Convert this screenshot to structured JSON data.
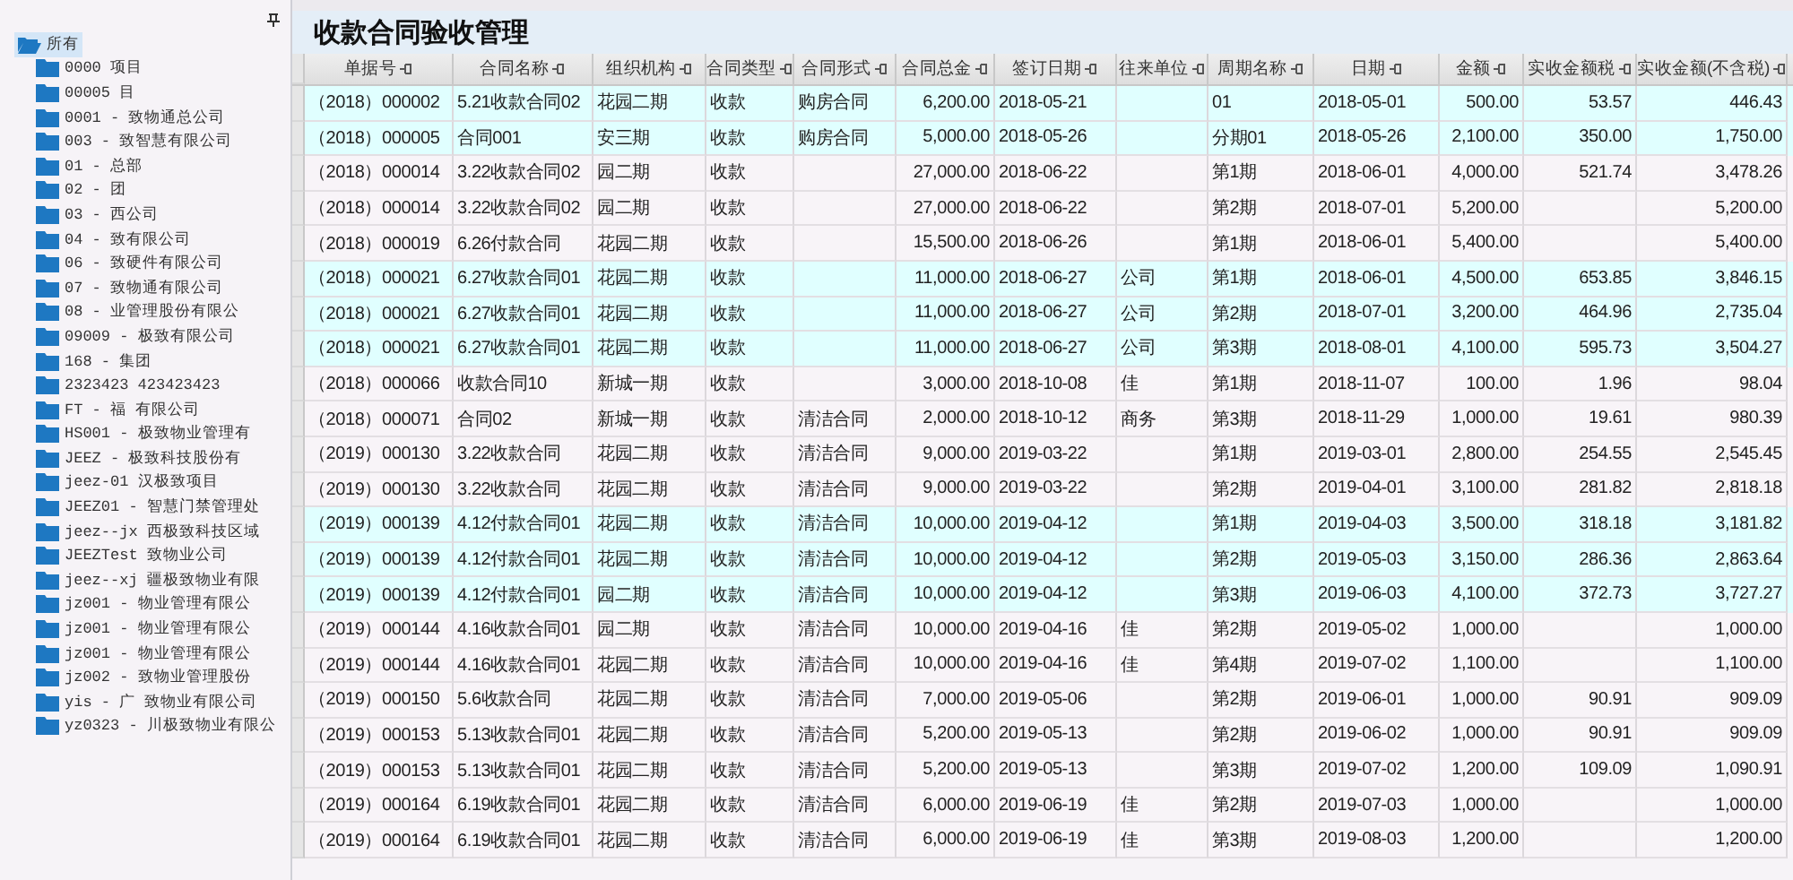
{
  "tree": {
    "root": {
      "label": "所有",
      "selected": true,
      "expanded": true,
      "children": [
        {
          "label": "0000 项目",
          "selected": false
        },
        {
          "label": "00005 目",
          "selected": false
        },
        {
          "label": "0001 - 致物通总公司",
          "selected": false
        },
        {
          "label": "003 - 致智慧有限公司",
          "selected": false
        },
        {
          "label": "01 - 总部",
          "selected": false
        },
        {
          "label": "02 - 团",
          "selected": false
        },
        {
          "label": "03 - 西公司",
          "selected": false
        },
        {
          "label": "04 - 致有限公司",
          "selected": false
        },
        {
          "label": "06 - 致硬件有限公司",
          "selected": false
        },
        {
          "label": "07 - 致物通有限公司",
          "selected": false
        },
        {
          "label": "08 - 业管理股份有限公",
          "selected": false
        },
        {
          "label": "09009 - 极致有限公司",
          "selected": false
        },
        {
          "label": "168 - 集团",
          "selected": false
        },
        {
          "label": "2323423 423423423",
          "selected": false
        },
        {
          "label": "FT - 福 有限公司",
          "selected": false
        },
        {
          "label": "HS001 - 极致物业管理有",
          "selected": false
        },
        {
          "label": "JEEZ - 极致科技股份有",
          "selected": false
        },
        {
          "label": "jeez-01 汉极致项目",
          "selected": false
        },
        {
          "label": "JEEZ01 - 智慧门禁管理处",
          "selected": false
        },
        {
          "label": "jeez--jx 西极致科技区域",
          "selected": false
        },
        {
          "label": "JEEZTest 致物业公司",
          "selected": false
        },
        {
          "label": "jeez--xj 疆极致物业有限",
          "selected": false
        },
        {
          "label": "jz001 - 物业管理有限公",
          "selected": false
        },
        {
          "label": "jz001 - 物业管理有限公",
          "selected": false
        },
        {
          "label": "jz001 - 物业管理有限公",
          "selected": false
        },
        {
          "label": "jz002 - 致物业管理股份",
          "selected": false
        },
        {
          "label": "yis - 广 致物业有限公司",
          "selected": false
        },
        {
          "label": "yz0323 - 川极致物业有限公",
          "selected": false
        }
      ]
    }
  },
  "title": "收款合同验收管理",
  "table": {
    "columns": [
      "单据号",
      "合同名称",
      "组织机构",
      "合同类型",
      "合同形式",
      "合同总金",
      "签订日期",
      "往来单位",
      "周期名称",
      "日期",
      "金额",
      "实收金额税",
      "实收金额(不含税)"
    ],
    "rows": [
      {
        "selected": true,
        "doc_no": "（2018）000002",
        "contract_name": "5.21收款合同02",
        "org": "花园二期",
        "contract_type": "收款",
        "contract_form": "购房合同",
        "total": "6,200.00",
        "sign_date": "2018-05-21",
        "period": "01",
        "date": "2018-05-01",
        "amount": "500.00",
        "tax": "53.57",
        "net": "446.43"
      },
      {
        "selected": true,
        "doc_no": "（2018）000005",
        "contract_name": "合同001",
        "org": "安三期",
        "contract_type": "收款",
        "contract_form": "购房合同",
        "total": "5,000.00",
        "sign_date": "2018-05-26",
        "period": "分期01",
        "date": "2018-05-26",
        "amount": "2,100.00",
        "tax": "350.00",
        "net": "1,750.00"
      },
      {
        "selected": false,
        "doc_no": "（2018）000014",
        "contract_name": "3.22收款合同02",
        "org": "园二期",
        "contract_type": "收款",
        "total": "27,000.00",
        "sign_date": "2018-06-22",
        "period": "第1期",
        "date": "2018-06-01",
        "amount": "4,000.00",
        "tax": "521.74",
        "net": "3,478.26"
      },
      {
        "selected": false,
        "doc_no": "（2018）000014",
        "contract_name": "3.22收款合同02",
        "org": "园二期",
        "contract_type": "收款",
        "total": "27,000.00",
        "sign_date": "2018-06-22",
        "period": "第2期",
        "date": "2018-07-01",
        "amount": "5,200.00",
        "net": "5,200.00"
      },
      {
        "selected": false,
        "doc_no": "（2018）000019",
        "contract_name": "6.26付款合同",
        "org": "花园二期",
        "contract_type": "收款",
        "total": "15,500.00",
        "sign_date": "2018-06-26",
        "period": "第1期",
        "date": "2018-06-01",
        "amount": "5,400.00",
        "net": "5,400.00"
      },
      {
        "selected": true,
        "doc_no": "（2018）000021",
        "contract_name": "6.27收款合同01",
        "org": "花园二期",
        "contract_type": "收款",
        "total": "11,000.00",
        "sign_date": "2018-06-27",
        "counterparty": "公司",
        "period": "第1期",
        "date": "2018-06-01",
        "amount": "4,500.00",
        "tax": "653.85",
        "net": "3,846.15"
      },
      {
        "selected": true,
        "doc_no": "（2018）000021",
        "contract_name": "6.27收款合同01",
        "org": "花园二期",
        "contract_type": "收款",
        "total": "11,000.00",
        "sign_date": "2018-06-27",
        "counterparty": "公司",
        "period": "第2期",
        "date": "2018-07-01",
        "amount": "3,200.00",
        "tax": "464.96",
        "net": "2,735.04"
      },
      {
        "selected": true,
        "doc_no": "（2018）000021",
        "contract_name": "6.27收款合同01",
        "org": "花园二期",
        "contract_type": "收款",
        "total": "11,000.00",
        "sign_date": "2018-06-27",
        "counterparty": "公司",
        "period": "第3期",
        "date": "2018-08-01",
        "amount": "4,100.00",
        "tax": "595.73",
        "net": "3,504.27"
      },
      {
        "selected": false,
        "doc_no": "（2018）000066",
        "contract_name": "收款合同10",
        "org": "新城一期",
        "contract_type": "收款",
        "total": "3,000.00",
        "sign_date": "2018-10-08",
        "counterparty": "佳",
        "period": "第1期",
        "date": "2018-11-07",
        "amount": "100.00",
        "tax": "1.96",
        "net": "98.04"
      },
      {
        "selected": false,
        "doc_no": "（2018）000071",
        "contract_name": "合同02",
        "org": "新城一期",
        "contract_type": "收款",
        "contract_form": "清洁合同",
        "total": "2,000.00",
        "sign_date": "2018-10-12",
        "counterparty": "商务",
        "period": "第3期",
        "date": "2018-11-29",
        "amount": "1,000.00",
        "tax": "19.61",
        "net": "980.39"
      },
      {
        "selected": false,
        "doc_no": "（2019）000130",
        "contract_name": "3.22收款合同",
        "org": "花园二期",
        "contract_type": "收款",
        "contract_form": "清洁合同",
        "total": "9,000.00",
        "sign_date": "2019-03-22",
        "period": "第1期",
        "date": "2019-03-01",
        "amount": "2,800.00",
        "tax": "254.55",
        "net": "2,545.45"
      },
      {
        "selected": false,
        "doc_no": "（2019）000130",
        "contract_name": "3.22收款合同",
        "org": "花园二期",
        "contract_type": "收款",
        "contract_form": "清洁合同",
        "total": "9,000.00",
        "sign_date": "2019-03-22",
        "period": "第2期",
        "date": "2019-04-01",
        "amount": "3,100.00",
        "tax": "281.82",
        "net": "2,818.18"
      },
      {
        "selected": true,
        "doc_no": "（2019）000139",
        "contract_name": "4.12付款合同01",
        "org": "花园二期",
        "contract_type": "收款",
        "contract_form": "清洁合同",
        "total": "10,000.00",
        "sign_date": "2019-04-12",
        "period": "第1期",
        "date": "2019-04-03",
        "amount": "3,500.00",
        "tax": "318.18",
        "net": "3,181.82"
      },
      {
        "selected": true,
        "doc_no": "（2019）000139",
        "contract_name": "4.12付款合同01",
        "org": "花园二期",
        "contract_type": "收款",
        "contract_form": "清洁合同",
        "total": "10,000.00",
        "sign_date": "2019-04-12",
        "period": "第2期",
        "date": "2019-05-03",
        "amount": "3,150.00",
        "tax": "286.36",
        "net": "2,863.64"
      },
      {
        "selected": true,
        "doc_no": "（2019）000139",
        "contract_name": "4.12付款合同01",
        "org": "园二期",
        "contract_type": "收款",
        "contract_form": "清洁合同",
        "total": "10,000.00",
        "sign_date": "2019-04-12",
        "period": "第3期",
        "date": "2019-06-03",
        "amount": "4,100.00",
        "tax": "372.73",
        "net": "3,727.27"
      },
      {
        "selected": false,
        "doc_no": "（2019）000144",
        "contract_name": "4.16收款合同01",
        "org": "园二期",
        "contract_type": "收款",
        "contract_form": "清洁合同",
        "total": "10,000.00",
        "sign_date": "2019-04-16",
        "counterparty": "佳",
        "period": "第2期",
        "date": "2019-05-02",
        "amount": "1,000.00",
        "net": "1,000.00"
      },
      {
        "selected": false,
        "doc_no": "（2019）000144",
        "contract_name": "4.16收款合同01",
        "org": "花园二期",
        "contract_type": "收款",
        "contract_form": "清洁合同",
        "total": "10,000.00",
        "sign_date": "2019-04-16",
        "counterparty": "佳",
        "period": "第4期",
        "date": "2019-07-02",
        "amount": "1,100.00",
        "net": "1,100.00"
      },
      {
        "selected": false,
        "doc_no": "（2019）000150",
        "contract_name": "5.6收款合同",
        "org": "花园二期",
        "contract_type": "收款",
        "contract_form": "清洁合同",
        "total": "7,000.00",
        "sign_date": "2019-05-06",
        "period": "第2期",
        "date": "2019-06-01",
        "amount": "1,000.00",
        "tax": "90.91",
        "net": "909.09"
      },
      {
        "selected": false,
        "doc_no": "（2019）000153",
        "contract_name": "5.13收款合同01",
        "org": "花园二期",
        "contract_type": "收款",
        "contract_form": "清洁合同",
        "total": "5,200.00",
        "sign_date": "2019-05-13",
        "period": "第2期",
        "date": "2019-06-02",
        "amount": "1,000.00",
        "tax": "90.91",
        "net": "909.09"
      },
      {
        "selected": false,
        "doc_no": "（2019）000153",
        "contract_name": "5.13收款合同01",
        "org": "花园二期",
        "contract_type": "收款",
        "contract_form": "清洁合同",
        "total": "5,200.00",
        "sign_date": "2019-05-13",
        "period": "第3期",
        "date": "2019-07-02",
        "amount": "1,200.00",
        "tax": "109.09",
        "net": "1,090.91"
      },
      {
        "selected": false,
        "doc_no": "（2019）000164",
        "contract_name": "6.19收款合同01",
        "org": "花园二期",
        "contract_type": "收款",
        "contract_form": "清洁合同",
        "total": "6,000.00",
        "sign_date": "2019-06-19",
        "counterparty": "佳",
        "period": "第2期",
        "date": "2019-07-03",
        "amount": "1,000.00",
        "net": "1,000.00"
      },
      {
        "selected": false,
        "doc_no": "（2019）000164",
        "contract_name": "6.19收款合同01",
        "org": "花园二期",
        "contract_type": "收款",
        "contract_form": "清洁合同",
        "total": "6,000.00",
        "sign_date": "2019-06-19",
        "counterparty": "佳",
        "period": "第3期",
        "date": "2019-08-03",
        "amount": "1,200.00",
        "net": "1,200.00"
      }
    ]
  }
}
